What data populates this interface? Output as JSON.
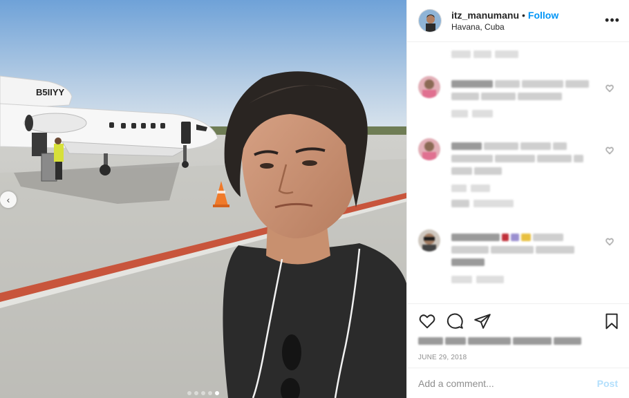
{
  "post": {
    "username": "itz_manumanu",
    "separator": "•",
    "follow_label": "Follow",
    "location": "Havana, Cuba",
    "more_icon": "more-options-icon",
    "date": "JUNE 29, 2018"
  },
  "photo": {
    "aircraft_registration": "B5IIYY",
    "carousel_count": 5,
    "carousel_active_index": 4
  },
  "actions": {
    "like_icon": "heart-icon",
    "comment_icon": "comment-icon",
    "share_icon": "share-icon",
    "save_icon": "bookmark-icon"
  },
  "comment_box": {
    "placeholder": "Add a comment...",
    "post_label": "Post"
  },
  "colors": {
    "accent": "#0095f6",
    "post_disabled": "#b2dffc",
    "border": "#efefef",
    "muted": "#8e8e8e"
  }
}
